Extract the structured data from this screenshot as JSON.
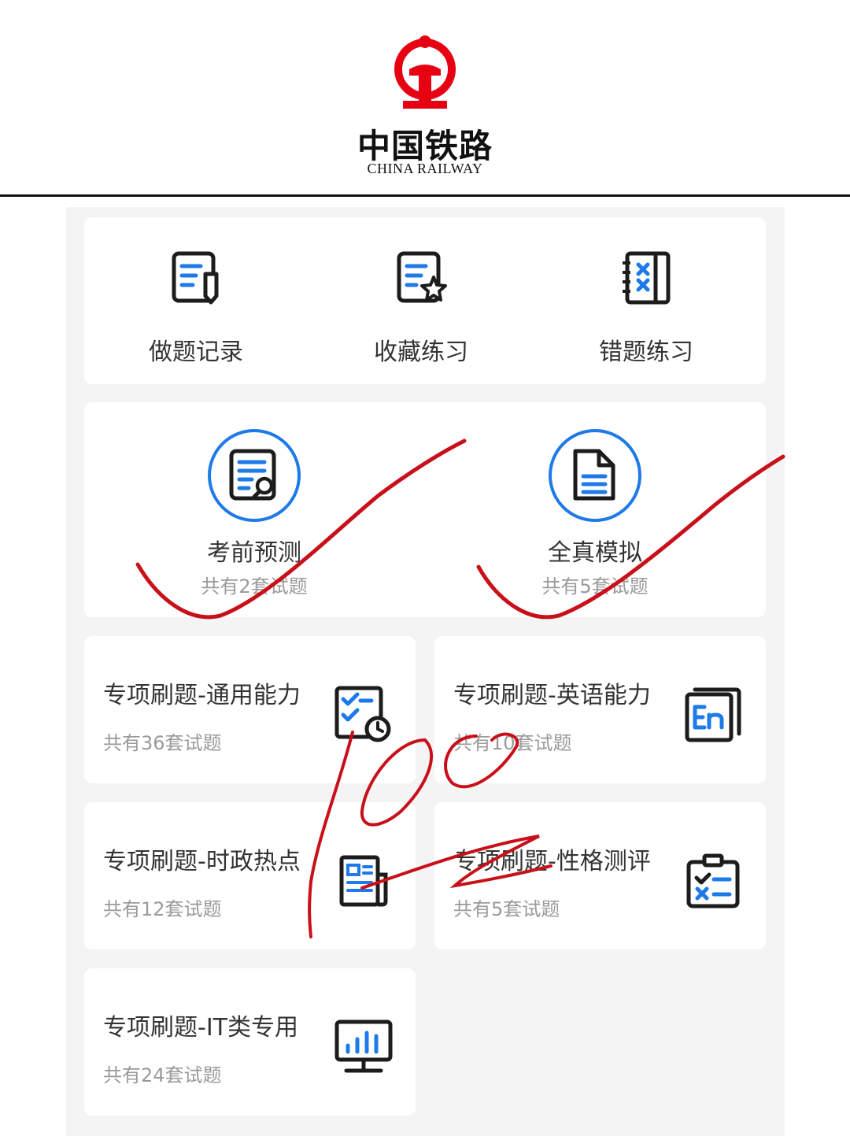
{
  "header": {
    "logo_cn": "中国铁路",
    "logo_en": "CHINA RAILWAY",
    "logo_icon": "china-railway-logo",
    "logo_color": "#e60012"
  },
  "quick_actions": [
    {
      "label": "做题记录",
      "icon": "record-list-pencil-icon"
    },
    {
      "label": "收藏练习",
      "icon": "favorite-list-star-icon"
    },
    {
      "label": "错题练习",
      "icon": "wrong-notebook-x-icon"
    }
  ],
  "featured": [
    {
      "title": "考前预测",
      "subtitle": "共有2套试题",
      "icon": "document-search-icon"
    },
    {
      "title": "全真模拟",
      "subtitle": "共有5套试题",
      "icon": "document-icon"
    }
  ],
  "topics": [
    {
      "title": "专项刷题-通用能力",
      "subtitle": "共有36套试题",
      "icon": "checklist-clock-icon"
    },
    {
      "title": "专项刷题-英语能力",
      "subtitle": "共有10套试题",
      "icon": "english-en-icon"
    },
    {
      "title": "专项刷题-时政热点",
      "subtitle": "共有12套试题",
      "icon": "newspaper-icon"
    },
    {
      "title": "专项刷题-性格测评",
      "subtitle": "共有5套试题",
      "icon": "clipboard-check-icon"
    },
    {
      "title": "专项刷题-IT类专用",
      "subtitle": "共有24套试题",
      "icon": "monitor-chart-icon"
    }
  ],
  "colors": {
    "accent": "#1e7ae8",
    "icon_dark": "#1c1c1c",
    "ink": "#c8101a",
    "background": "#f4f4f5"
  }
}
